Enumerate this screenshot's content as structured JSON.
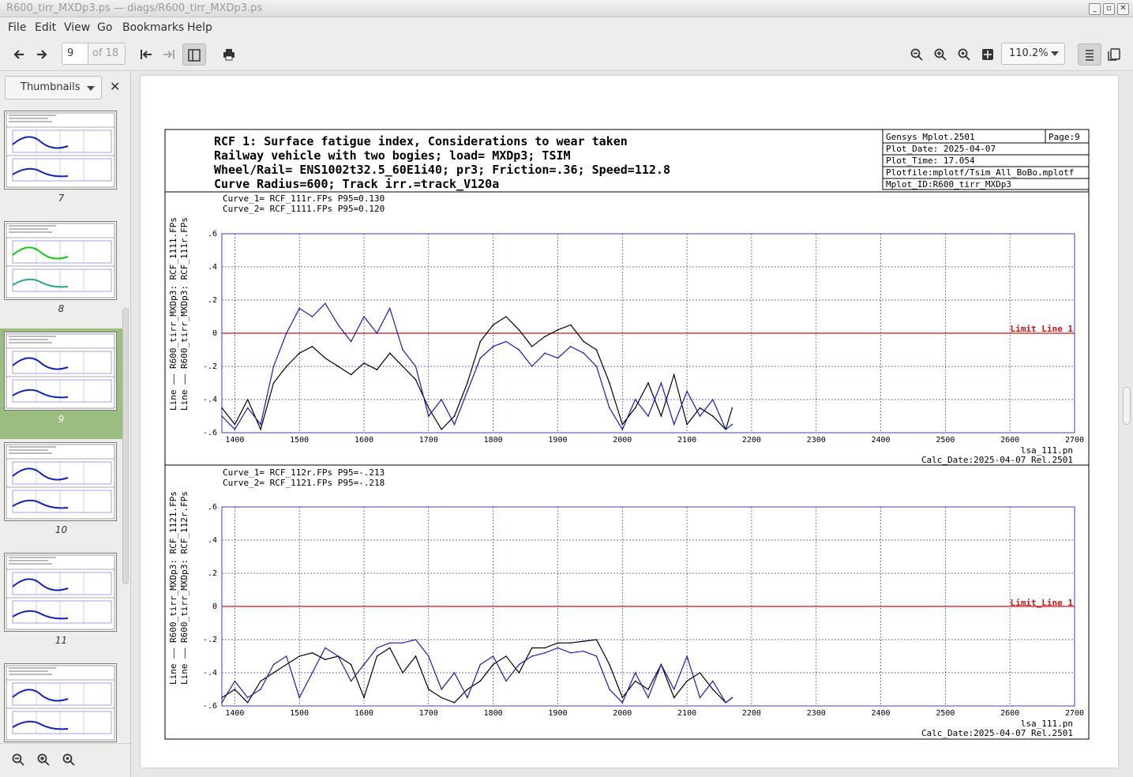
{
  "window": {
    "title": "R600_tirr_MXDp3.ps — diags/R600_tirr_MXDp3.ps"
  },
  "menu": [
    "File",
    "Edit",
    "View",
    "Go",
    "Bookmarks",
    "Help"
  ],
  "toolbar": {
    "page_value": "9",
    "page_count": "of 18",
    "zoom": "110.2%"
  },
  "sidebar": {
    "mode": "Thumbnails",
    "thumbnails": [
      "7",
      "8",
      "9",
      "10",
      "11",
      ""
    ],
    "selected": "9"
  },
  "plot": {
    "header": {
      "title_lines": [
        "RCF 1: Surface fatigue index, Considerations to wear taken",
        "Railway vehicle with two bogies; load= MXDp3; TSIM",
        "Wheel/Rail= ENS1002t32.5_60E1i40; pr3; Friction=.36; Speed=112.8",
        "Curve Radius=600; Track irr.=track_V120a"
      ],
      "info": {
        "program": "Gensys Mplot.2501",
        "page": "Page:9",
        "plot_date": "Plot_Date: 2025-04-07",
        "plot_time": "Plot_Time: 17.054",
        "plotfile": "Plotfile:mplotf/Tsim_All_BoBo.mplotf",
        "mplot_id": "Mplot_ID:R600_tirr_MXDp3"
      }
    },
    "colors": {
      "curve1": "#000000",
      "curve2": "#1a1ab8",
      "limit": "#d01010",
      "grid": "#3a3ad0"
    },
    "panels": [
      {
        "curve_lines": [
          "Curve_1= RCF_111r.FPs  P95=0.130",
          "Curve_2= RCF_1111.FPs  P95=0.120"
        ],
        "ylabel_lines": [
          "Line —— R600_tirr_MXDp3: RCF_1111.FPs",
          "Line —— R600_tirr_MXDp3: RCF_111r.FPs"
        ],
        "limit_label": "Limit_Line 1",
        "footer1": "lsa_111.pn",
        "footer2": "Calc_Date:2025-04-07 Rel.2501"
      },
      {
        "curve_lines": [
          "Curve_1= RCF_112r.FPs  P95=-.213",
          "Curve_2= RCF_1121.FPs  P95=-.218"
        ],
        "ylabel_lines": [
          "Line —— R600_tirr_MXDp3: RCF_1121.FPs",
          "Line —— R600_tirr_MXDp3: RCF_112r.FPs"
        ],
        "limit_label": "Limit_Line 1",
        "footer1": "lsa_111.pn",
        "footer2": "Calc_Date:2025-04-07 Rel.2501"
      }
    ]
  },
  "chart_data": [
    {
      "type": "line",
      "xlim": [
        1380,
        2700
      ],
      "ylim": [
        -0.6,
        0.6
      ],
      "x_ticks": [
        "1400",
        "1500",
        "1600",
        "1700",
        "1800",
        "1900",
        "2000",
        "2100",
        "2200",
        "2300",
        "2400",
        "2500",
        "2600",
        "2700"
      ],
      "y_ticks": [
        ".6",
        ".4",
        ".2",
        "0",
        "-.2",
        "-.4",
        "-.6"
      ],
      "limit_line": 0,
      "series": [
        {
          "name": "Curve_1",
          "x": [
            1380,
            1400,
            1420,
            1440,
            1460,
            1480,
            1500,
            1520,
            1540,
            1560,
            1580,
            1600,
            1620,
            1640,
            1660,
            1680,
            1700,
            1720,
            1740,
            1760,
            1780,
            1800,
            1820,
            1840,
            1860,
            1880,
            1900,
            1920,
            1940,
            1960,
            1980,
            2000,
            2020,
            2040,
            2060,
            2080,
            2100,
            2120,
            2140,
            2160,
            2170
          ],
          "y": [
            -0.45,
            -0.55,
            -0.4,
            -0.58,
            -0.3,
            -0.2,
            -0.12,
            -0.08,
            -0.15,
            -0.2,
            -0.25,
            -0.18,
            -0.22,
            -0.12,
            -0.2,
            -0.28,
            -0.45,
            -0.58,
            -0.5,
            -0.3,
            -0.05,
            0.05,
            0.1,
            0.02,
            -0.08,
            -0.02,
            0.02,
            0.05,
            -0.05,
            -0.1,
            -0.3,
            -0.55,
            -0.45,
            -0.3,
            -0.5,
            -0.25,
            -0.55,
            -0.45,
            -0.5,
            -0.58,
            -0.45
          ]
        },
        {
          "name": "Curve_2",
          "x": [
            1380,
            1400,
            1420,
            1440,
            1460,
            1480,
            1500,
            1520,
            1540,
            1560,
            1580,
            1600,
            1620,
            1640,
            1660,
            1680,
            1700,
            1720,
            1740,
            1760,
            1780,
            1800,
            1820,
            1840,
            1860,
            1880,
            1900,
            1920,
            1940,
            1960,
            1980,
            2000,
            2020,
            2040,
            2060,
            2080,
            2100,
            2120,
            2140,
            2160,
            2170
          ],
          "y": [
            -0.5,
            -0.58,
            -0.45,
            -0.55,
            -0.2,
            0.0,
            0.15,
            0.1,
            0.18,
            0.05,
            -0.05,
            0.1,
            0.0,
            0.15,
            -0.1,
            -0.2,
            -0.5,
            -0.4,
            -0.55,
            -0.35,
            -0.15,
            -0.08,
            -0.05,
            -0.1,
            -0.2,
            -0.12,
            -0.15,
            -0.08,
            -0.12,
            -0.2,
            -0.45,
            -0.58,
            -0.4,
            -0.5,
            -0.3,
            -0.55,
            -0.35,
            -0.5,
            -0.4,
            -0.58,
            -0.55
          ]
        }
      ]
    },
    {
      "type": "line",
      "xlim": [
        1380,
        2700
      ],
      "ylim": [
        -0.6,
        0.6
      ],
      "x_ticks": [
        "1400",
        "1500",
        "1600",
        "1700",
        "1800",
        "1900",
        "2000",
        "2100",
        "2200",
        "2300",
        "2400",
        "2500",
        "2600",
        "2700"
      ],
      "y_ticks": [
        ".6",
        ".4",
        ".2",
        "0",
        "-.2",
        "-.4",
        "-.6"
      ],
      "limit_line": 0,
      "series": [
        {
          "name": "Curve_1",
          "x": [
            1380,
            1400,
            1420,
            1440,
            1460,
            1480,
            1500,
            1520,
            1540,
            1560,
            1580,
            1600,
            1620,
            1640,
            1660,
            1680,
            1700,
            1720,
            1740,
            1760,
            1780,
            1800,
            1820,
            1840,
            1860,
            1880,
            1900,
            1920,
            1940,
            1960,
            1980,
            2000,
            2020,
            2040,
            2060,
            2080,
            2100,
            2120,
            2140,
            2160,
            2170
          ],
          "y": [
            -0.55,
            -0.5,
            -0.58,
            -0.45,
            -0.4,
            -0.35,
            -0.3,
            -0.28,
            -0.32,
            -0.3,
            -0.35,
            -0.55,
            -0.3,
            -0.25,
            -0.4,
            -0.3,
            -0.5,
            -0.55,
            -0.58,
            -0.5,
            -0.45,
            -0.35,
            -0.3,
            -0.4,
            -0.25,
            -0.25,
            -0.22,
            -0.22,
            -0.21,
            -0.2,
            -0.35,
            -0.55,
            -0.45,
            -0.5,
            -0.35,
            -0.55,
            -0.45,
            -0.4,
            -0.5,
            -0.58,
            -0.55
          ]
        },
        {
          "name": "Curve_2",
          "x": [
            1380,
            1400,
            1420,
            1440,
            1460,
            1480,
            1500,
            1520,
            1540,
            1560,
            1580,
            1600,
            1620,
            1640,
            1660,
            1680,
            1700,
            1720,
            1740,
            1760,
            1780,
            1800,
            1820,
            1840,
            1860,
            1880,
            1900,
            1920,
            1940,
            1960,
            1980,
            2000,
            2020,
            2040,
            2060,
            2080,
            2100,
            2120,
            2140,
            2160,
            2170
          ],
          "y": [
            -0.58,
            -0.45,
            -0.55,
            -0.5,
            -0.35,
            -0.3,
            -0.55,
            -0.4,
            -0.25,
            -0.3,
            -0.45,
            -0.35,
            -0.25,
            -0.22,
            -0.22,
            -0.2,
            -0.3,
            -0.5,
            -0.4,
            -0.55,
            -0.35,
            -0.3,
            -0.45,
            -0.35,
            -0.3,
            -0.28,
            -0.25,
            -0.28,
            -0.27,
            -0.3,
            -0.5,
            -0.58,
            -0.4,
            -0.55,
            -0.35,
            -0.5,
            -0.3,
            -0.55,
            -0.45,
            -0.58,
            -0.55
          ]
        }
      ]
    }
  ]
}
